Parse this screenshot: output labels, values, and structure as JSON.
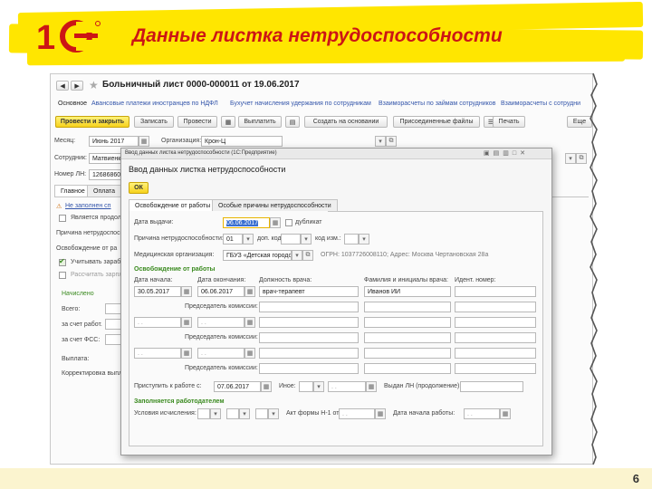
{
  "slide": {
    "title": "Данные листка нетрудоспособности",
    "logo_text": "1С",
    "page_number": "6",
    "colors": {
      "brand_yellow": "#ffe600",
      "title_red": "#cc1515",
      "accent_green": "#3a8a1f"
    }
  },
  "doc": {
    "title": "Больничный лист 0000-000011 от 19.06.2017",
    "nav_links": [
      "Основное",
      "Авансовые платежи иностранцев по НДФЛ",
      "Бухучет начисления удержания по сотрудникам",
      "Взаиморасчеты по займам сотрудников",
      "Взаиморасчеты с сотрудни"
    ],
    "toolbar": {
      "post_close": "Провести и закрыть",
      "save": "Записать",
      "post": "Провести",
      "pay": "Выплатить",
      "create_based": "Создать на основании",
      "attached": "Присоединенные файлы",
      "print": "Печать",
      "more": "Еще"
    },
    "fields": {
      "month_label": "Месяц:",
      "month_value": "Июнь 2017",
      "org_label": "Организация:",
      "org_value": "Крон-Ц",
      "employee_label": "Сотрудник:",
      "employee_value": "Матвиенк",
      "ln_number_label": "Номер ЛН:",
      "ln_number_value": "12686860"
    },
    "tabs": [
      "Главное",
      "Оплата"
    ],
    "left_panel": {
      "not_filled": "Не заполнен сп",
      "is_continuation": "Является продол",
      "cause": "Причина нетрудоспособ",
      "release": "Освобождение от ра",
      "consider_earnings": "Учитывать зарабо",
      "calc_wage": "Рассчитать зарпл",
      "accrued": "Начислено",
      "total": "Всего:",
      "employer": "за счет работ.",
      "fss": "за счет ФСС:",
      "payout": "Выплата:",
      "adjust": "Корректировка выпла"
    }
  },
  "dialog": {
    "window_title": "Ввод данных листка нетрудоспособности  (1С:Предприятие)",
    "header": "Ввод данных листка нетрудоспособности",
    "ok": "ОК",
    "tabs": [
      "Освобождение от работы",
      "Особые причины нетрудоспособности"
    ],
    "issue_date_label": "Дата выдачи:",
    "issue_date_value": "06.06.2017",
    "duplicate_label": "дубликат",
    "cause_label": "Причина нетрудоспособности:",
    "cause_code": "01",
    "add_code_label": "доп. код:",
    "code_change_label": "код изм.:",
    "med_org_label": "Медицинская организация:",
    "med_org_value": "ГБУЗ «Детская городская",
    "med_org_info": "ОГРН: 1037726008110; Адрес: Москва Чертановская 28а",
    "release_section": "Освобождение от работы",
    "col_start": "Дата начала:",
    "col_end": "Дата окончания:",
    "col_position": "Должность врача:",
    "col_name": "Фамилия и инициалы врача:",
    "col_id": "Идент. номер:",
    "row1_start": "30.05.2017",
    "row1_end": "06.06.2017",
    "row1_position": "врач-терапевт",
    "row1_name": "Иванов ИИ",
    "commission_chair": "Председатель комиссии:",
    "date_placeholder": ". .",
    "return_work_label": "Приступить к работе с:",
    "return_work_value": "07.06.2017",
    "other_label": "Иное:",
    "issued_cont_label": "Выдан ЛН (продолжение) №:",
    "employer_section": "Заполняется работодателем",
    "conditions_label": "Условия исчисления:",
    "act_label": "Акт формы Н-1 от:",
    "work_start_label": "Дата начала работы:"
  },
  "icons": [
    "back-arrow-icon",
    "forward-arrow-icon",
    "star-icon",
    "calendar-icon",
    "dropdown-icon",
    "link-icon",
    "dialog-window-icons"
  ]
}
